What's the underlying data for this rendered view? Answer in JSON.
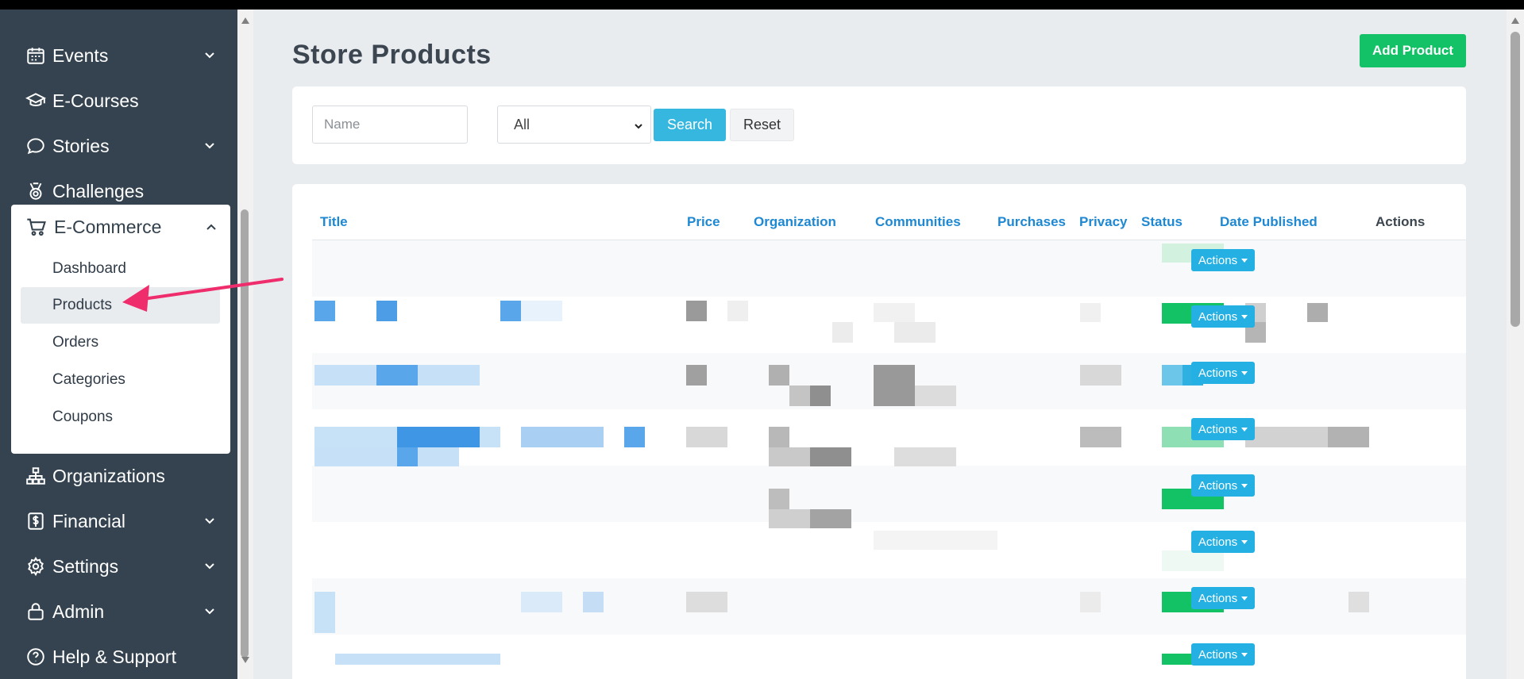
{
  "sidebar": {
    "items": [
      {
        "label": "Events",
        "icon": "calendar-icon"
      },
      {
        "label": "E-Courses",
        "icon": "graduation-cap-icon"
      },
      {
        "label": "Stories",
        "icon": "chat-bubble-icon"
      },
      {
        "label": "Challenges",
        "icon": "medal-icon"
      },
      {
        "label": "E-Commerce",
        "icon": "cart-icon"
      },
      {
        "label": "Organizations",
        "icon": "org-chart-icon"
      },
      {
        "label": "Financial",
        "icon": "dollar-doc-icon"
      },
      {
        "label": "Settings",
        "icon": "gear-icon"
      },
      {
        "label": "Admin",
        "icon": "lock-icon"
      },
      {
        "label": "Help & Support",
        "icon": "help-icon"
      }
    ],
    "ecommerce_sub": [
      "Dashboard",
      "Products",
      "Orders",
      "Categories",
      "Coupons"
    ],
    "active_sub": "Products"
  },
  "main": {
    "title": "Store Products",
    "add_button": "Add Product",
    "filters": {
      "name_placeholder": "Name",
      "select_value": "All",
      "search_label": "Search",
      "reset_label": "Reset"
    },
    "table": {
      "headers": [
        "Title",
        "Price",
        "Organization",
        "Communities",
        "Purchases",
        "Privacy",
        "Status",
        "Date Published",
        "Actions"
      ],
      "action_label": "Actions"
    }
  },
  "colors": {
    "sidebar_bg": "#34434f",
    "accent_green": "#13c266",
    "accent_blue": "#36b7e0",
    "link_blue": "#1e88d2",
    "arrow_pink": "#ef2d6c"
  }
}
